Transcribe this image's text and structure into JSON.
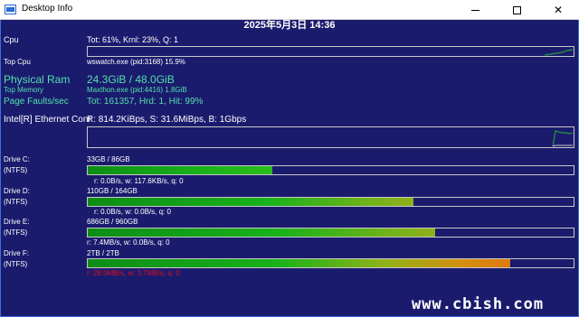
{
  "window": {
    "title": "Desktop Info",
    "icon": "app-window-icon",
    "controls": [
      "minimize-icon",
      "maximize-icon",
      "close-icon"
    ]
  },
  "datetime": "2025年5月3日 14:36",
  "cpu": {
    "label": "Cpu",
    "value": "Tot: 61%, Krnl: 23%, Q: 1",
    "top_label": "Top Cpu",
    "top_value": "wswatch.exe (pid:3168) 15.9%"
  },
  "memory": {
    "label": "Physical Ram",
    "value": "24.3GiB / 48.0GiB",
    "top_label": "Top Memory",
    "top_value": "Maxthon.exe (pid:4416) 1.8GiB",
    "faults_label": "Page Faults/sec",
    "faults_value": "Tot: 161357, Hrd: 1, Hit: 99%"
  },
  "network": {
    "label": "Intel[R] Ethernet Conr",
    "value": "R: 814.2KiBps, S: 31.6MiBps, B: 1Gbps"
  },
  "drives": [
    {
      "name": "Drive C:",
      "fs": "(NTFS)",
      "usage": "33GB / 86GB",
      "fraction": 0.38,
      "io": "r: 0.0B/s, w: 117.6KB/s, q: 0"
    },
    {
      "name": "Drive D:",
      "fs": "(NTFS)",
      "usage": "110GB / 164GB",
      "fraction": 0.67,
      "io": "r: 0.0B/s, w: 0.0B/s, q: 0"
    },
    {
      "name": "Drive E:",
      "fs": "(NTFS)",
      "usage": "686GB / 960GB",
      "fraction": 0.715,
      "io": "r: 7.4MB/s, w: 0.0B/s, q: 0"
    },
    {
      "name": "Drive F:",
      "fs": "(NTFS)",
      "usage": "2TB / 2TB",
      "fraction": 0.87,
      "io": "r: 28.0MB/s, w: 3.7MB/s, q: 0"
    }
  ],
  "watermark": "www.cbish.com",
  "colors": {
    "background": "#1b1b6e",
    "highlight_text": "#52e0a8",
    "alert_text": "#e0101a",
    "bar_fill": "#18b21a"
  }
}
